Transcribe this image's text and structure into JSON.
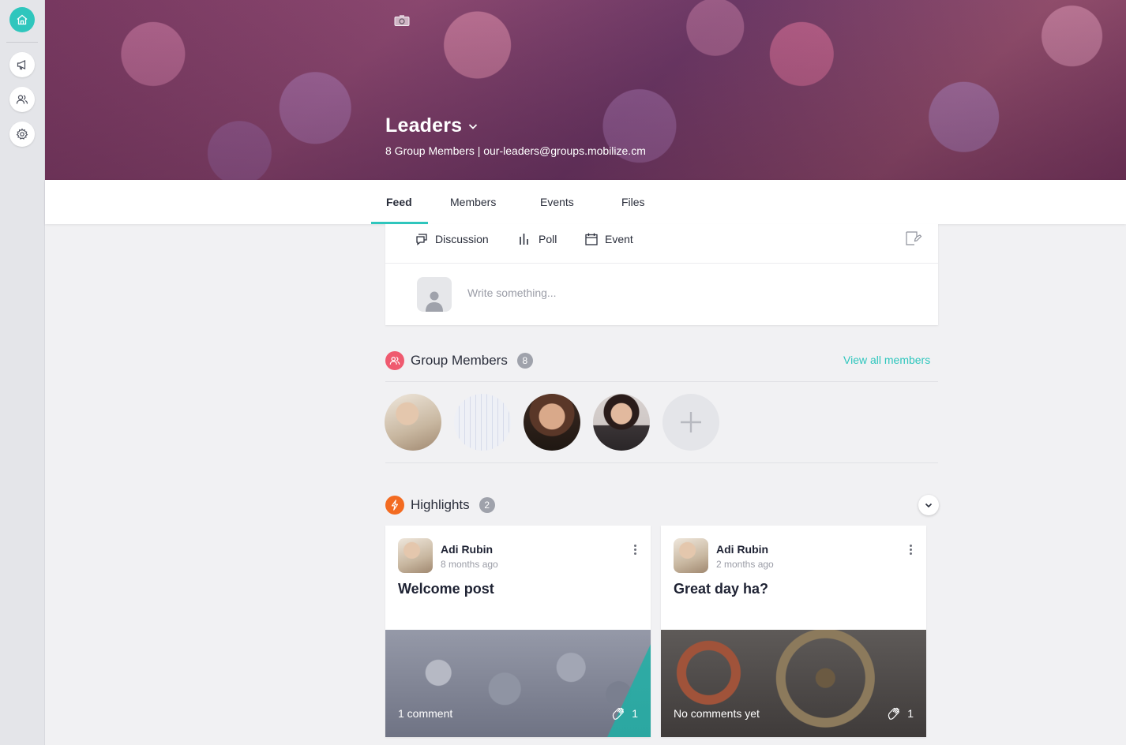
{
  "sidebar": {
    "items": [
      {
        "name": "home-icon",
        "active": true
      },
      {
        "name": "megaphone-icon",
        "active": false
      },
      {
        "name": "people-icon",
        "active": false
      },
      {
        "name": "gear-icon",
        "active": false
      }
    ]
  },
  "group": {
    "name": "Leaders",
    "subtitle": "8 Group Members | our-leaders@groups.mobilize.cm"
  },
  "tabs": [
    {
      "label": "Feed",
      "active": true
    },
    {
      "label": "Members",
      "active": false
    },
    {
      "label": "Events",
      "active": false
    },
    {
      "label": "Files",
      "active": false
    }
  ],
  "composer": {
    "options": [
      {
        "label": "Discussion",
        "icon": "discussion-icon"
      },
      {
        "label": "Poll",
        "icon": "poll-icon"
      },
      {
        "label": "Event",
        "icon": "calendar-icon"
      }
    ],
    "placeholder": "Write something..."
  },
  "members_section": {
    "title": "Group Members",
    "count": "8",
    "view_all": "View all members"
  },
  "highlights_section": {
    "title": "Highlights",
    "count": "2"
  },
  "highlights": [
    {
      "author": "Adi Rubin",
      "time": "8 months ago",
      "title": "Welcome post",
      "comments": "1 comment",
      "claps": "1"
    },
    {
      "author": "Adi Rubin",
      "time": "2 months ago",
      "title": "Great day ha?",
      "comments": "No comments yet",
      "claps": "1"
    }
  ],
  "colors": {
    "accent": "#2fc6bd",
    "members_icon_bg": "#ef5a6f",
    "highlights_icon_bg": "#f36b21"
  }
}
